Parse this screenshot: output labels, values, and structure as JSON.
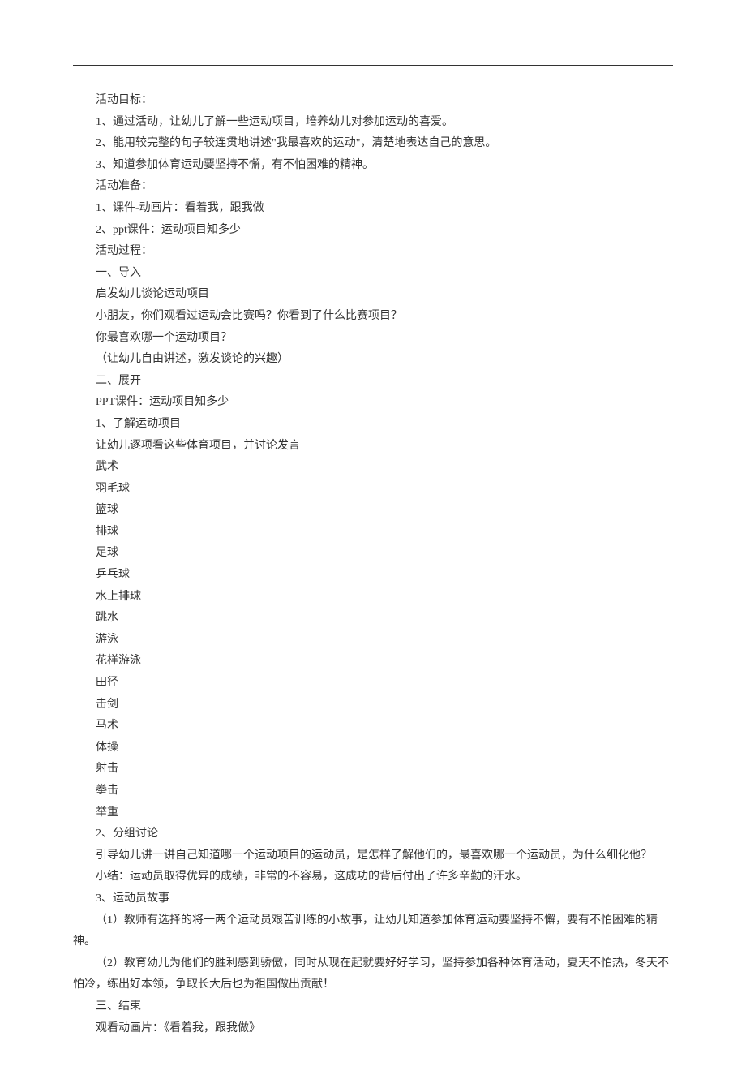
{
  "lines": [
    "活动目标：",
    "1、通过活动，让幼儿了解一些运动项目，培养幼儿对参加运动的喜爱。",
    "2、能用较完整的句子较连贯地讲述\"我最喜欢的运动\"，清楚地表达自己的意思。",
    "3、知道参加体育运动要坚持不懈，有不怕困难的精神。",
    "活动准备：",
    "1、课件-动画片：看着我，跟我做",
    "2、ppt课件：运动项目知多少",
    "活动过程：",
    "一、导入",
    "启发幼儿谈论运动项目",
    "小朋友，你们观看过运动会比赛吗？你看到了什么比赛项目？",
    "你最喜欢哪一个运动项目？",
    "（让幼儿自由讲述，激发谈论的兴趣）",
    "二、展开",
    "PPT课件：运动项目知多少",
    "1、了解运动项目",
    "让幼儿逐项看这些体育项目，并讨论发言",
    "武术",
    "羽毛球",
    "篮球",
    "排球",
    "足球",
    "乒乓球",
    "水上排球",
    "跳水",
    "游泳",
    "花样游泳",
    "田径",
    "击剑",
    "马术",
    "体操",
    "射击",
    "拳击",
    "举重",
    "2、分组讨论",
    "引导幼儿讲一讲自己知道哪一个运动项目的运动员，是怎样了解他们的，最喜欢哪一个运动员，为什么细化他？",
    "小结：运动员取得优异的成绩，非常的不容易，这成功的背后付出了许多辛勤的汗水。",
    "3、运动员故事"
  ],
  "para_a": "（1）教师有选择的将一两个运动员艰苦训练的小故事，让幼儿知道参加体育运动要坚持不懈，要有不怕困难的精神。",
  "para_b": "（2）教育幼儿为他们的胜利感到骄傲，同时从现在起就要好好学习，坚持参加各种体育活动，夏天不怕热，冬天不怕冷，练出好本领，争取长大后也为祖国做出贡献！",
  "lines_end": [
    "三、结束",
    "观看动画片：《看着我，跟我做》"
  ]
}
